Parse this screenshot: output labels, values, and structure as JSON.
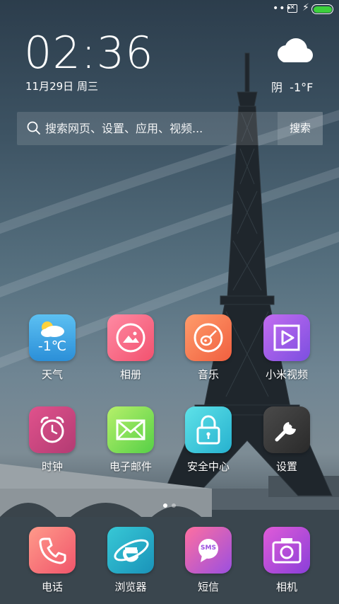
{
  "status_bar": {
    "more_icon": "ellipsis-icon",
    "sim_icon": "no-sim-icon",
    "charging_icon": "charging-bolt-icon",
    "battery_level": 1.0,
    "battery_color": "#3ccf3c"
  },
  "clock": {
    "time": "02:36",
    "date": "11月29日 周三"
  },
  "weather": {
    "icon": "cloud-icon",
    "text": "阴  -1°F"
  },
  "search": {
    "placeholder": "搜索网页、设置、应用、视频...",
    "button_label": "搜索"
  },
  "apps": [
    {
      "label": "天气",
      "icon": "weather-icon",
      "badge_text": "-1℃"
    },
    {
      "label": "相册",
      "icon": "gallery-icon"
    },
    {
      "label": "音乐",
      "icon": "music-icon"
    },
    {
      "label": "小米视频",
      "icon": "video-icon"
    },
    {
      "label": "时钟",
      "icon": "clock-icon"
    },
    {
      "label": "电子邮件",
      "icon": "email-icon"
    },
    {
      "label": "安全中心",
      "icon": "security-icon"
    },
    {
      "label": "设置",
      "icon": "settings-icon"
    }
  ],
  "page_indicator": {
    "pages": 2,
    "active": 1
  },
  "dock": [
    {
      "label": "电话",
      "icon": "phone-icon"
    },
    {
      "label": "浏览器",
      "icon": "browser-icon"
    },
    {
      "label": "短信",
      "icon": "sms-icon",
      "badge_text": "SMS"
    },
    {
      "label": "相机",
      "icon": "camera-icon"
    }
  ]
}
